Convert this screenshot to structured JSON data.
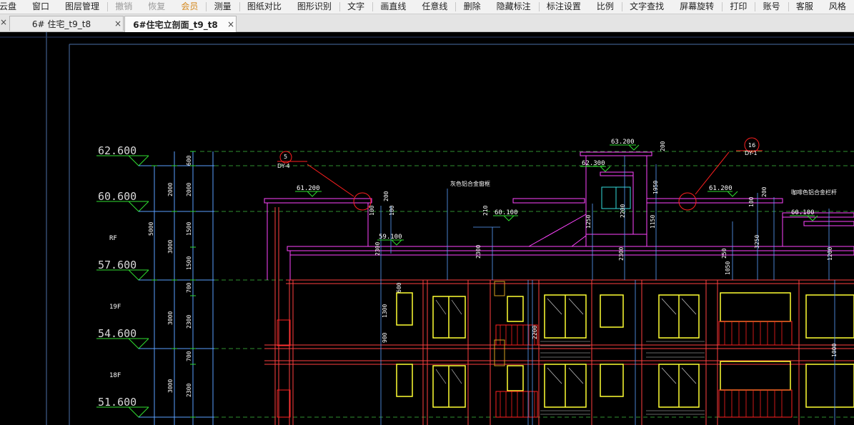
{
  "menubar": {
    "items": [
      "云盘",
      "窗口",
      "图层管理",
      "撤销",
      "恢复",
      "会员",
      "测量",
      "图纸对比",
      "图形识别",
      "文字",
      "画直线",
      "任意线",
      "删除",
      "隐藏标注",
      "标注设置",
      "比例",
      "文字查找",
      "屏幕旋转",
      "打印",
      "账号",
      "客服",
      "风格"
    ]
  },
  "tabs": [
    {
      "label": "6# 住宅_t9_t8",
      "close": "×"
    },
    {
      "label": "6#住宅立剖面_t9_t8",
      "close": "×"
    }
  ],
  "drawing": {
    "levels": [
      "62.600",
      "60.600",
      "57.600",
      "54.600",
      "51.600"
    ],
    "floor_labels": [
      "RF",
      "19F",
      "18F"
    ],
    "small_levels": [
      "61.200",
      "60.100",
      "59.100",
      "62.300",
      "63.200",
      "61.200",
      "60.100"
    ],
    "dims_outer": [
      "5000",
      "3000",
      "3000"
    ],
    "dims_inner": [
      "2000",
      "3000",
      "3000"
    ],
    "dims_seg": [
      "600",
      "2000",
      "1500",
      "1500",
      "700",
      "2300",
      "700",
      "2300"
    ],
    "dims_misc": [
      "100",
      "200",
      "100",
      "2300",
      "2300",
      "100",
      "1950",
      "2300",
      "250",
      "1050",
      "3250",
      "2200",
      "1200",
      "1250",
      "1150",
      "1000",
      "900",
      "1300",
      "600",
      "2200",
      "200",
      "200",
      "210"
    ],
    "annotations": [
      "灰色铝合金窗框",
      "咖啡色铝合金栏杆"
    ],
    "callouts": [
      {
        "num": "5",
        "code": "DY-4"
      },
      {
        "num": "16",
        "code": "DY-1"
      }
    ]
  }
}
